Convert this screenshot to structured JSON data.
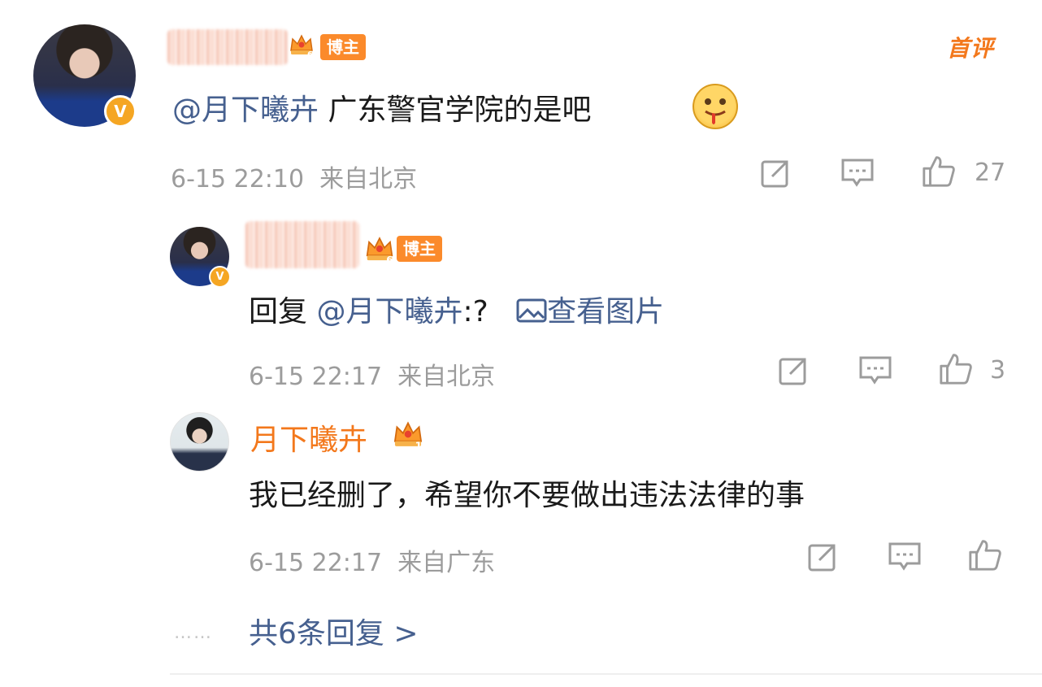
{
  "main_comment": {
    "avatar_name": "main-commenter-avatar",
    "role_tag": "博主",
    "corner_tag": "首评",
    "mention": "@月下曦卉",
    "text": " 广东警官学院的是吧",
    "time": "6-15 22:10",
    "location": "来自北京",
    "likes": "27"
  },
  "reply_comment": {
    "role_tag": "博主",
    "reply_prefix": "回复 ",
    "mention": "@月下曦卉",
    "text": ":?",
    "view_image": "查看图片",
    "time": "6-15 22:17",
    "location": "来自北京",
    "likes": "3"
  },
  "sub_comment": {
    "username": "月下曦卉",
    "text": "我已经删了，希望你不要做出违法法律的事",
    "time": "6-15 22:17",
    "location": "来自广东"
  },
  "more": {
    "dots": "……",
    "label": "共6条回复 >"
  },
  "colors": {
    "accent_orange": "#f3781c",
    "link_blue": "#46608f",
    "meta_gray": "#9c9c9c",
    "vip_badge": "#f5a623"
  },
  "icons": [
    "share-icon",
    "comment-icon",
    "like-icon",
    "crown-icon",
    "verified-icon",
    "image-icon"
  ]
}
